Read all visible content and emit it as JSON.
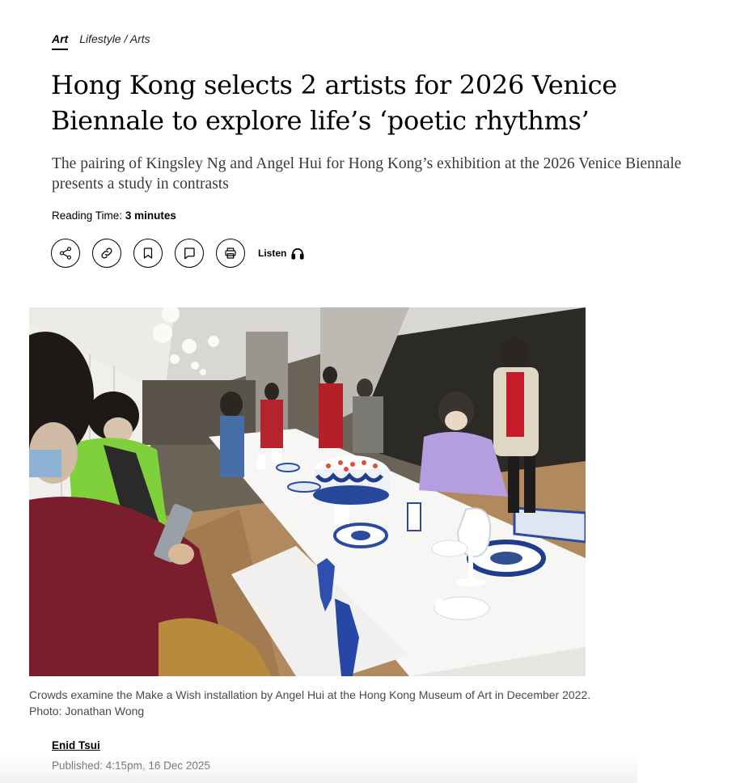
{
  "article": {
    "topic": "Art",
    "breadcrumb": "Lifestyle / Arts",
    "headline": "Hong Kong selects 2 artists for 2026 Venice Biennale to explore life’s ‘poetic rhythms’",
    "subheadline": "The pairing of Kingsley Ng and Angel Hui for Hong Kong’s exhibition at the 2026 Venice Biennale presents a study in contrasts",
    "reading_time_label": "Reading Time:",
    "reading_time_value": "3 minutes",
    "actions": {
      "share_icon": "share-icon",
      "link_icon": "link-icon",
      "bookmark_icon": "bookmark-icon",
      "comment_icon": "comment-icon",
      "print_icon": "print-icon",
      "listen_label": "Listen",
      "listen_icon": "headphones-icon"
    },
    "image": {
      "caption": "Crowds examine the Make a Wish installation by Angel Hui at the Hong Kong Museum of Art in December 2022. Photo: Jonathan Wong"
    },
    "author": "Enid Tsui",
    "published": "Published: 4:15pm, 16 Dec 2025"
  }
}
